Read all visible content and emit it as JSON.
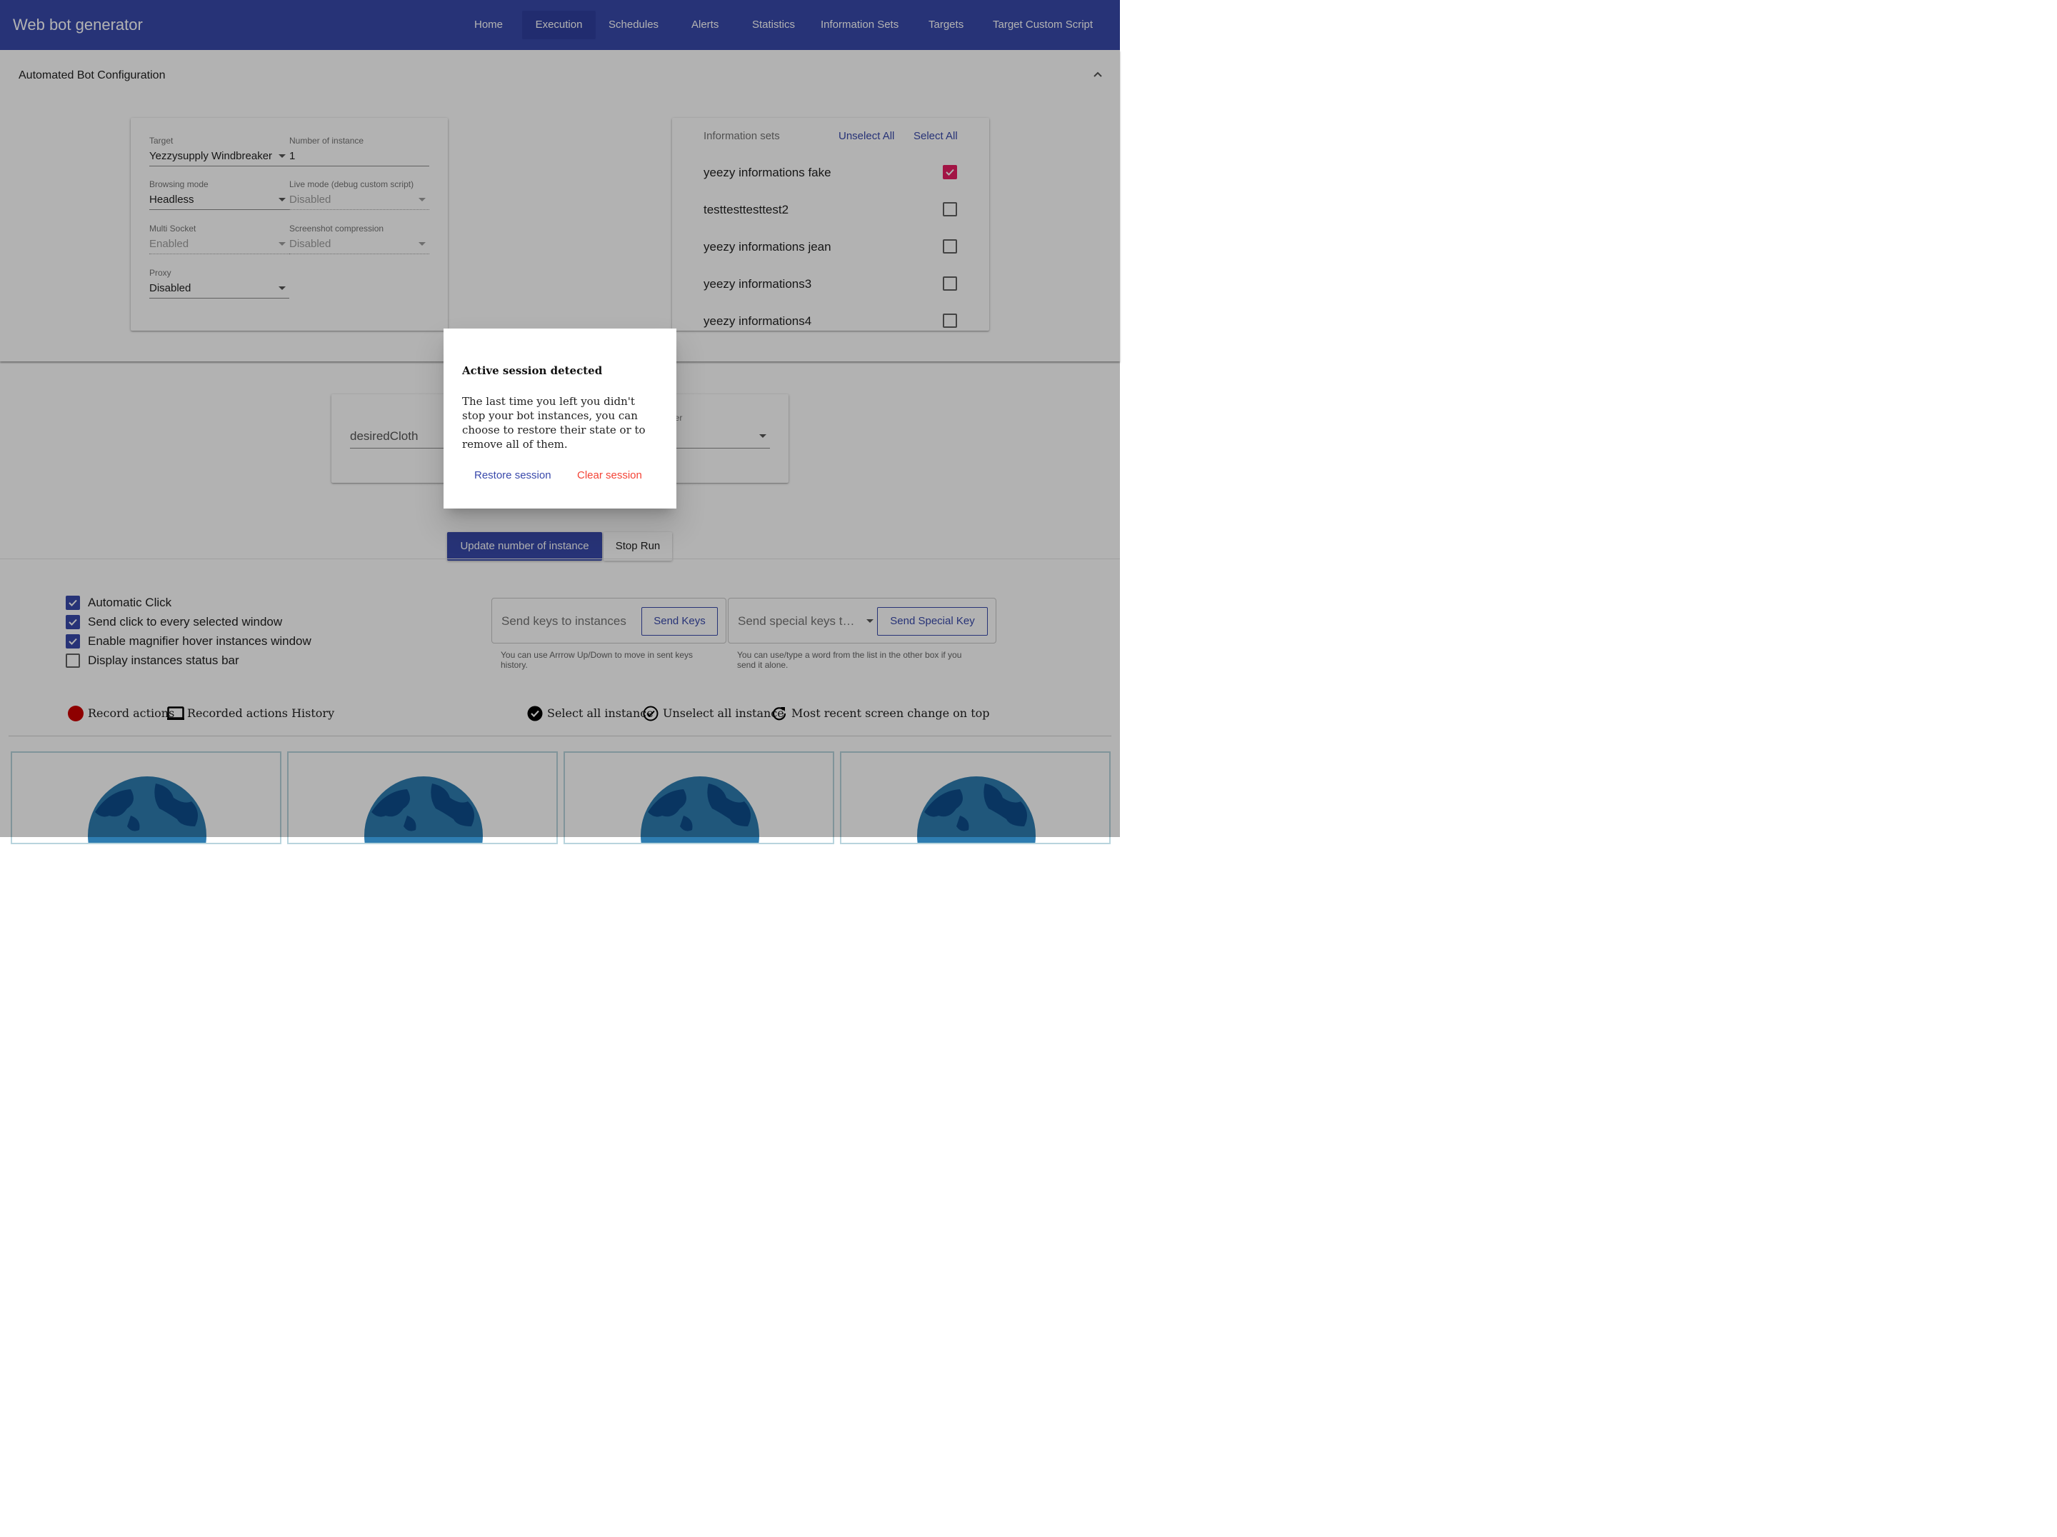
{
  "app": {
    "title": "Web bot generator"
  },
  "nav": {
    "items": [
      {
        "label": "Home"
      },
      {
        "label": "Execution"
      },
      {
        "label": "Schedules"
      },
      {
        "label": "Alerts"
      },
      {
        "label": "Statistics"
      },
      {
        "label": "Information Sets"
      },
      {
        "label": "Targets"
      },
      {
        "label": "Target Custom Script"
      }
    ],
    "active": "Execution"
  },
  "config": {
    "panel_title": "Automated Bot Configuration",
    "target": {
      "label": "Target",
      "value": "Yezzysupply Windbreaker"
    },
    "instances": {
      "label": "Number of instance",
      "value": "1"
    },
    "browsing": {
      "label": "Browsing mode",
      "value": "Headless"
    },
    "live": {
      "label": "Live mode (debug custom script)",
      "value": "Disabled"
    },
    "multisocket": {
      "label": "Multi Socket",
      "value": "Enabled"
    },
    "compression": {
      "label": "Screenshot compression",
      "value": "Disabled"
    },
    "proxy": {
      "label": "Proxy",
      "value": "Disabled"
    }
  },
  "info_sets": {
    "header": "Information sets",
    "unselect_all": "Unselect All",
    "select_all": "Select All",
    "items": [
      {
        "label": "yeezy informations fake",
        "checked": true
      },
      {
        "label": "testtesttesttest2",
        "checked": false
      },
      {
        "label": "yeezy informations jean",
        "checked": false
      },
      {
        "label": "yeezy informations3",
        "checked": false
      },
      {
        "label": "yeezy informations4",
        "checked": false
      }
    ]
  },
  "params": {
    "field_value": "desiredCloth",
    "partial_label": "rder"
  },
  "actions": {
    "update": "Update number of instance",
    "stop": "Stop Run"
  },
  "options": [
    {
      "label": "Automatic Click",
      "checked": true
    },
    {
      "label": "Send click to every selected window",
      "checked": true
    },
    {
      "label": "Enable magnifier hover instances window",
      "checked": true
    },
    {
      "label": "Display instances status bar",
      "checked": false
    }
  ],
  "send_keys": {
    "placeholder": "Send keys to instances",
    "button": "Send Keys",
    "hint": "You can use Arrrow Up/Down to move in sent keys history."
  },
  "special_keys": {
    "placeholder": "Send special keys t…",
    "button": "Send Special Key",
    "hint": "You can use/type a word from the list in the other box if you send it alone."
  },
  "toolbar": {
    "record": "Record actions",
    "history": "Recorded actions History",
    "select_all": "Select all instance",
    "unselect_all": "Unselect all instance",
    "recent": "Most recent screen change on top"
  },
  "dialog": {
    "title": "Active session detected",
    "body": "The last time you left you didn't stop your bot instances, you can choose to restore their state or to remove all of them.",
    "restore": "Restore session",
    "clear": "Clear session"
  },
  "colors": {
    "primary": "#3949ab",
    "accent": "#e91e63",
    "danger": "#f44336",
    "record": "#cc0000"
  }
}
